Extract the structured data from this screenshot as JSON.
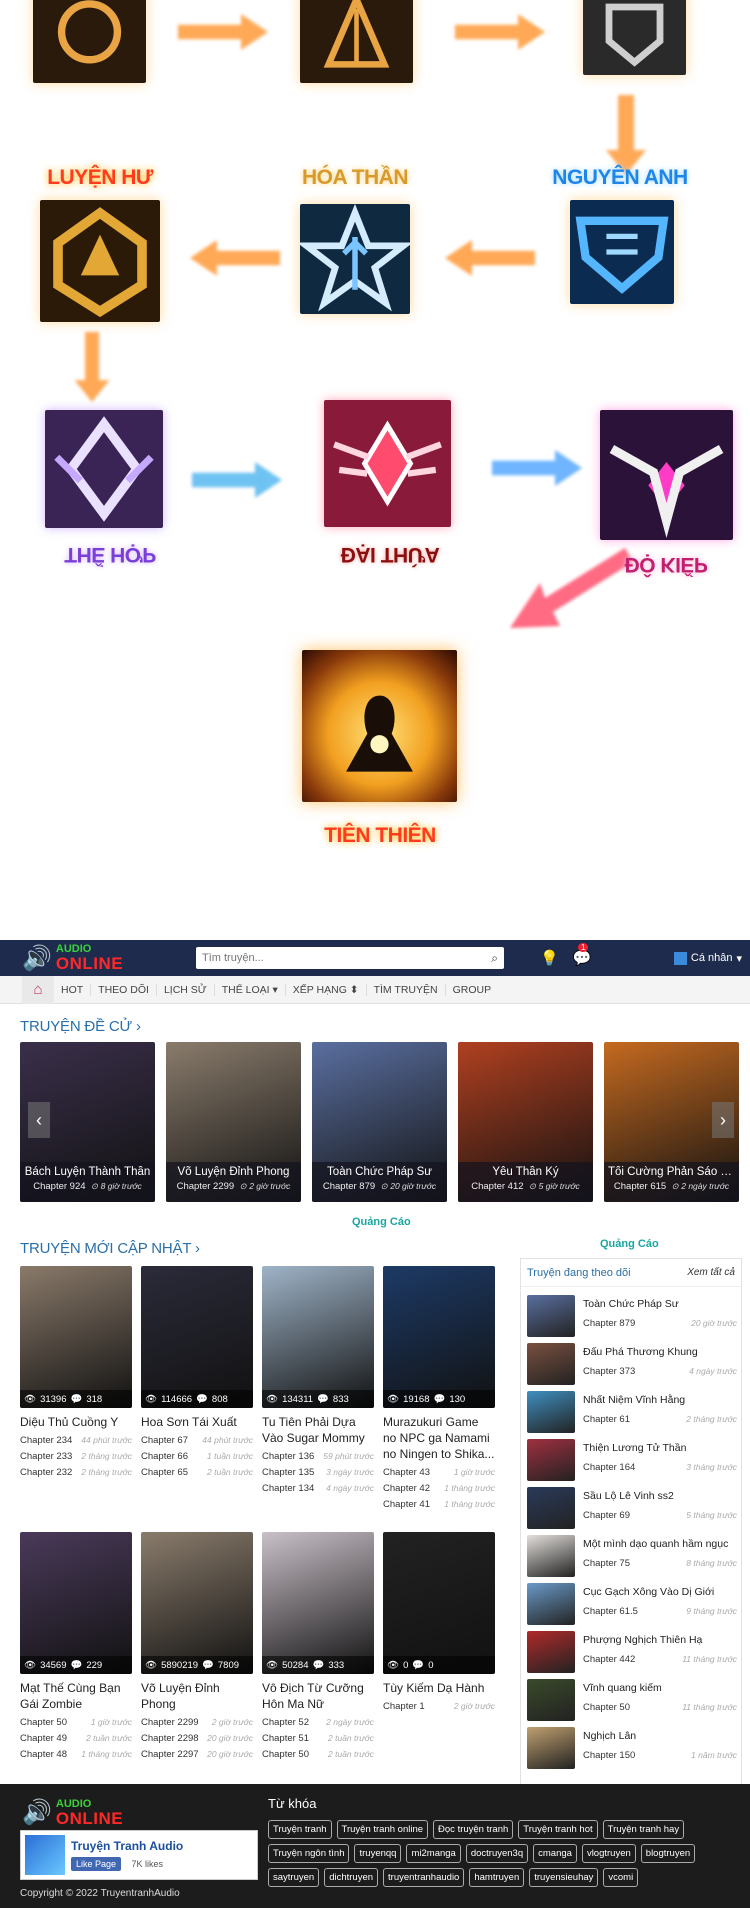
{
  "diagram": {
    "stages": [
      {
        "label": "LUYỆN HƯ",
        "style": "red"
      },
      {
        "label": "HÓA THẦN",
        "style": "gold"
      },
      {
        "label": "NGUYÊN ANH",
        "style": "blue"
      },
      {
        "label": "THỂ HỢP",
        "style": "purple"
      },
      {
        "label": "ĐẠI THỪA",
        "style": "darkred"
      },
      {
        "label": "ĐỘ KIẾP",
        "style": "magenta"
      },
      {
        "label": "TIÊN THIÊN",
        "style": "red"
      }
    ]
  },
  "header": {
    "logo_top": "AUDIO",
    "logo_bottom": "ONLINE",
    "search_placeholder": "Tìm truyện...",
    "notification_count": "1",
    "user_label": "Cá nhân"
  },
  "nav": {
    "items": [
      "HOT",
      "THEO DÕI",
      "LỊCH SỬ",
      "THỂ LOẠI ▾",
      "XẾP HẠNG ⬍",
      "TÌM TRUYỆN",
      "GROUP"
    ]
  },
  "featured": {
    "title": "TRUYỆN ĐỀ CỬ ›",
    "cards": [
      {
        "title": "Bách Luyện Thành Thần",
        "chapter": "Chapter 924",
        "time": "8 giờ trước",
        "color": "#3a2f4a"
      },
      {
        "title": "Võ Luyện Đỉnh Phong",
        "chapter": "Chapter 2299",
        "time": "2 giờ trước",
        "color": "#8a7c6c"
      },
      {
        "title": "Toàn Chức Pháp Sư",
        "chapter": "Chapter 879",
        "time": "20 giờ trước",
        "color": "#5a6fa0"
      },
      {
        "title": "Yêu Thần Ký",
        "chapter": "Chapter 412",
        "time": "5 giờ trước",
        "color": "#b04020"
      },
      {
        "title": "Tối Cường Phản Sáo Lộ Hệ Thống",
        "chapter": "Chapter 615",
        "time": "2 ngày trước",
        "color": "#c56a20"
      }
    ]
  },
  "ad_label": "Quảng Cáo",
  "updates": {
    "title": "TRUYỆN MỚI CẬP NHẬT ›",
    "items": [
      {
        "title": "Diệu Thủ Cuồng Y",
        "views": "31396",
        "comments": "318",
        "color": "#8a7a6a",
        "chapters": [
          [
            "Chapter 234",
            "44 phút trước"
          ],
          [
            "Chapter 233",
            "2 tháng trước"
          ],
          [
            "Chapter 232",
            "2 tháng trước"
          ]
        ]
      },
      {
        "title": "Hoa Sơn Tái Xuất",
        "views": "114666",
        "comments": "808",
        "color": "#2b2b3a",
        "chapters": [
          [
            "Chapter 67",
            "44 phút trước"
          ],
          [
            "Chapter 66",
            "1 tuần trước"
          ],
          [
            "Chapter 65",
            "2 tuần trước"
          ]
        ]
      },
      {
        "title": "Tu Tiên Phải Dựa Vào Sugar Mommy",
        "views": "134311",
        "comments": "833",
        "color": "#9fb4c8",
        "chapters": [
          [
            "Chapter 136",
            "59 phút trước"
          ],
          [
            "Chapter 135",
            "3 ngày trước"
          ],
          [
            "Chapter 134",
            "4 ngày trước"
          ]
        ]
      },
      {
        "title": "Murazukuri Game no NPC ga Namami no Ningen to Shika...",
        "views": "19168",
        "comments": "130",
        "color": "#1d3a66",
        "chapters": [
          [
            "Chapter 43",
            "1 giờ trước"
          ],
          [
            "Chapter 42",
            "1 tháng trước"
          ],
          [
            "Chapter 41",
            "1 tháng trước"
          ]
        ]
      },
      {
        "title": "Mạt Thế Cùng Bạn Gái Zombie",
        "views": "34569",
        "comments": "229",
        "color": "#4a3a5a",
        "chapters": [
          [
            "Chapter 50",
            "1 giờ trước"
          ],
          [
            "Chapter 49",
            "2 tuần trước"
          ],
          [
            "Chapter 48",
            "1 tháng trước"
          ]
        ]
      },
      {
        "title": "Võ Luyện Đỉnh Phong",
        "views": "5890219",
        "comments": "7809",
        "color": "#8a7c6c",
        "chapters": [
          [
            "Chapter 2299",
            "2 giờ trước"
          ],
          [
            "Chapter 2298",
            "20 giờ trước"
          ],
          [
            "Chapter 2297",
            "20 giờ trước"
          ]
        ]
      },
      {
        "title": "Vô Địch Từ Cưỡng Hôn Ma Nữ",
        "views": "50284",
        "comments": "333",
        "color": "#c9c0c8",
        "chapters": [
          [
            "Chapter 52",
            "2 ngày trước"
          ],
          [
            "Chapter 51",
            "2 tuần trước"
          ],
          [
            "Chapter 50",
            "2 tuần trước"
          ]
        ]
      },
      {
        "title": "Tùy Kiếm Dạ Hành",
        "views": "0",
        "comments": "0",
        "color": "#222",
        "chapters": [
          [
            "Chapter 1",
            "2 giờ trước"
          ]
        ]
      }
    ]
  },
  "following": {
    "title": "Truyện đang theo dõi",
    "see_all": "Xem tất cả",
    "items": [
      {
        "title": "Toàn Chức Pháp Sư",
        "chapter": "Chapter 879",
        "time": "20 giờ trước",
        "color": "#5a6fa0"
      },
      {
        "title": "Đấu Phá Thương Khung",
        "chapter": "Chapter 373",
        "time": "4 ngày trước",
        "color": "#7a5040"
      },
      {
        "title": "Nhất Niệm Vĩnh Hằng",
        "chapter": "Chapter 61",
        "time": "2 tháng trước",
        "color": "#3f8fc0"
      },
      {
        "title": "Thiện Lương Tử Thần",
        "chapter": "Chapter 164",
        "time": "3 tháng trước",
        "color": "#a03040"
      },
      {
        "title": "Sầu Lộ Lê Vinh ss2",
        "chapter": "Chapter 69",
        "time": "5 tháng trước",
        "color": "#2a3a5a"
      },
      {
        "title": "Một mình dạo quanh hầm ngục",
        "chapter": "Chapter 75",
        "time": "8 tháng trước",
        "color": "#e4e0dc"
      },
      {
        "title": "Cục Gạch Xông Vào Dị Giới",
        "chapter": "Chapter 61.5",
        "time": "9 tháng trước",
        "color": "#6a9ac8"
      },
      {
        "title": "Phượng Nghịch Thiên Hạ",
        "chapter": "Chapter 442",
        "time": "11 tháng trước",
        "color": "#b02a2a"
      },
      {
        "title": "Vĩnh quang kiếm",
        "chapter": "Chapter 50",
        "time": "11 tháng trước",
        "color": "#3a4a2a"
      },
      {
        "title": "Nghịch Lân",
        "chapter": "Chapter 150",
        "time": "1 năm trước",
        "color": "#c0a070"
      }
    ]
  },
  "footer": {
    "logo_top": "AUDIO",
    "logo_bottom": "ONLINE",
    "fb_name": "Truyện Tranh Audio",
    "fb_like": "Like Page",
    "fb_count": "7K likes",
    "copyright": "Copyright © 2022 TruyentranhAudio",
    "keywords_title": "Từ khóa",
    "keywords": [
      "Truyện tranh",
      "Truyện tranh online",
      "Đọc truyện tranh",
      "Truyện tranh hot",
      "Truyện tranh hay",
      "Truyện ngôn tình",
      "truyenqq",
      "mi2manga",
      "doctruyen3q",
      "cmanga",
      "vlogtruyen",
      "blogtruyen",
      "saytruyen",
      "dichtruyen",
      "truyentranhaudio",
      "hamtruyen",
      "truyensieuhay",
      "vcomi"
    ]
  }
}
